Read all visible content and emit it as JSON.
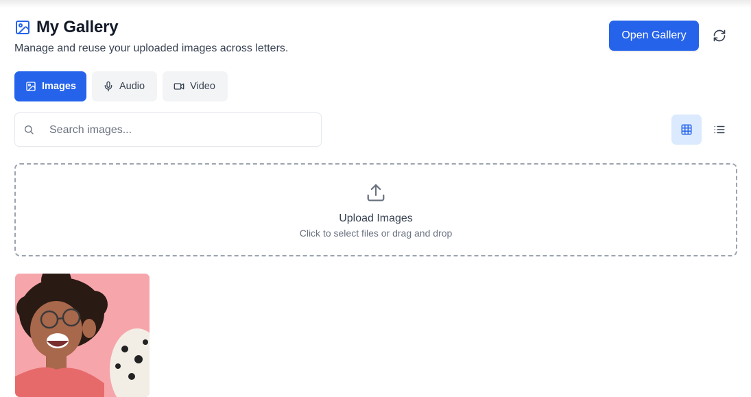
{
  "header": {
    "title": "My Gallery",
    "subtitle": "Manage and reuse your uploaded images across letters.",
    "title_icon": "image-icon"
  },
  "actions": {
    "open_gallery_label": "Open Gallery",
    "refresh_icon": "refresh-icon"
  },
  "tabs": [
    {
      "label": "Images",
      "icon": "image-icon",
      "active": true
    },
    {
      "label": "Audio",
      "icon": "mic-icon",
      "active": false
    },
    {
      "label": "Video",
      "icon": "video-icon",
      "active": false
    }
  ],
  "search": {
    "placeholder": "Search images...",
    "value": ""
  },
  "view_toggle": {
    "selected": "grid",
    "options": [
      "grid-icon",
      "list-icon"
    ]
  },
  "upload": {
    "title": "Upload Images",
    "subtitle": "Click to select files or drag and drop",
    "icon": "upload-icon"
  },
  "gallery": {
    "items": [
      {
        "description_icon": "image-thumbnail"
      }
    ]
  },
  "colors": {
    "accent": "#2563eb",
    "accent_light": "#dbeafe",
    "tab_inactive_bg": "#f3f4f6",
    "thumbnail_bg": "#f8a8ad"
  }
}
